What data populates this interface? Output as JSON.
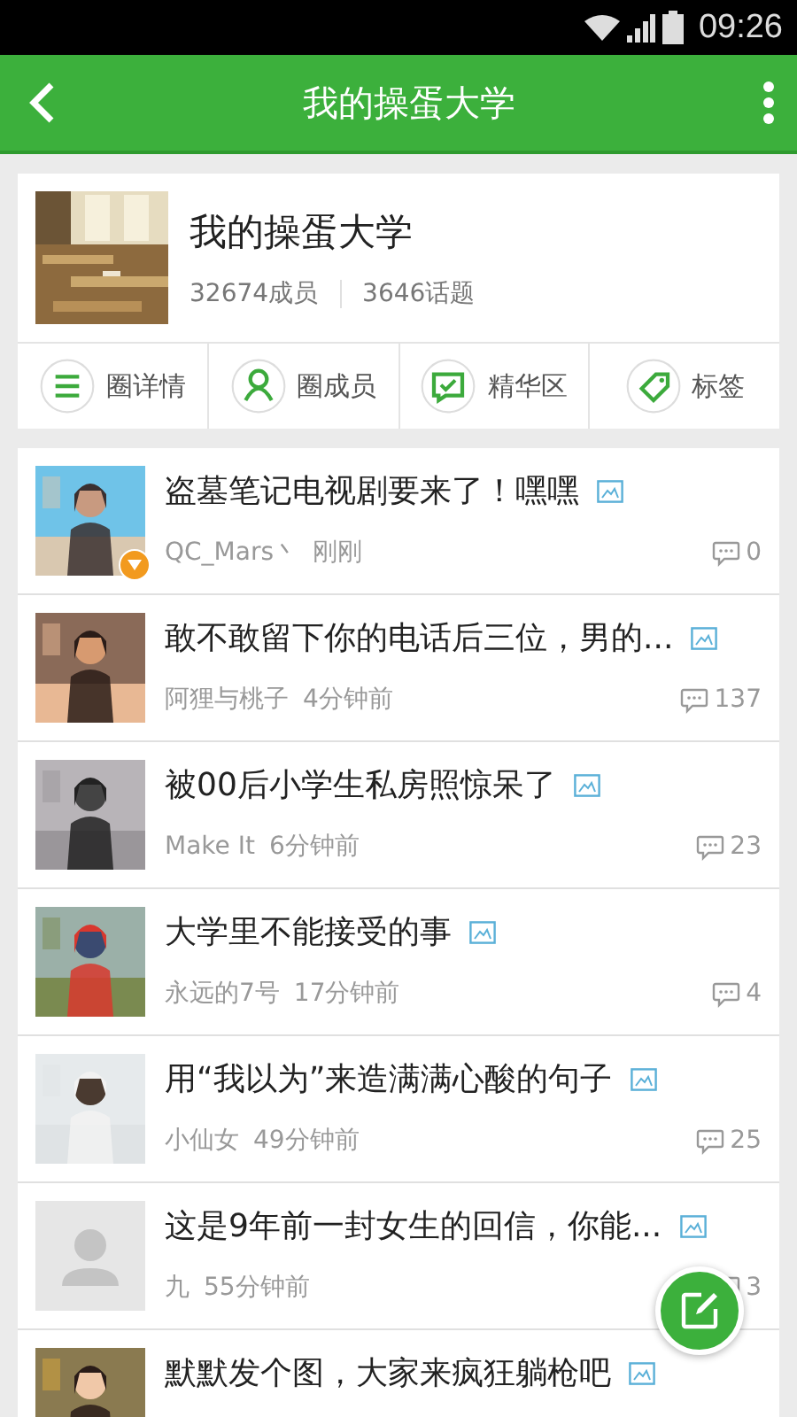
{
  "status_bar": {
    "time": "09:26"
  },
  "header": {
    "title": "我的操蛋大学"
  },
  "group": {
    "name": "我的操蛋大学",
    "members": "32674成员",
    "topics": "3646话题"
  },
  "nav": [
    {
      "kind": "list",
      "label": "圈详情"
    },
    {
      "kind": "person",
      "label": "圈成员"
    },
    {
      "kind": "chat",
      "label": "精华区"
    },
    {
      "kind": "tag",
      "label": "标签"
    }
  ],
  "posts": [
    {
      "badge": true,
      "title": "盗墓笔记电视剧要来了！嘿嘿",
      "has_image": true,
      "author": "QC_Mars丶",
      "time": "刚刚",
      "comments": "0"
    },
    {
      "badge": false,
      "title": "敢不敢留下你的电话后三位，男的...",
      "has_image": true,
      "author": "阿狸与桃子",
      "time": "4分钟前",
      "comments": "137"
    },
    {
      "badge": false,
      "title": "被00后小学生私房照惊呆了",
      "has_image": true,
      "author": "Make It",
      "time": "6分钟前",
      "comments": "23"
    },
    {
      "badge": false,
      "title": "大学里不能接受的事",
      "has_image": true,
      "author": "永远的7号",
      "time": "17分钟前",
      "comments": "4"
    },
    {
      "badge": false,
      "title": "用“我以为”来造满满心酸的句子",
      "has_image": true,
      "author": "小仙女",
      "time": "49分钟前",
      "comments": "25"
    },
    {
      "kind": "default",
      "badge": false,
      "title": "这是9年前一封女生的回信，你能...",
      "has_image": true,
      "author": "九",
      "time": "55分钟前",
      "comments": "3"
    },
    {
      "badge": false,
      "title": "默默发个图，大家来疯狂躺枪吧",
      "has_image": true
    }
  ]
}
